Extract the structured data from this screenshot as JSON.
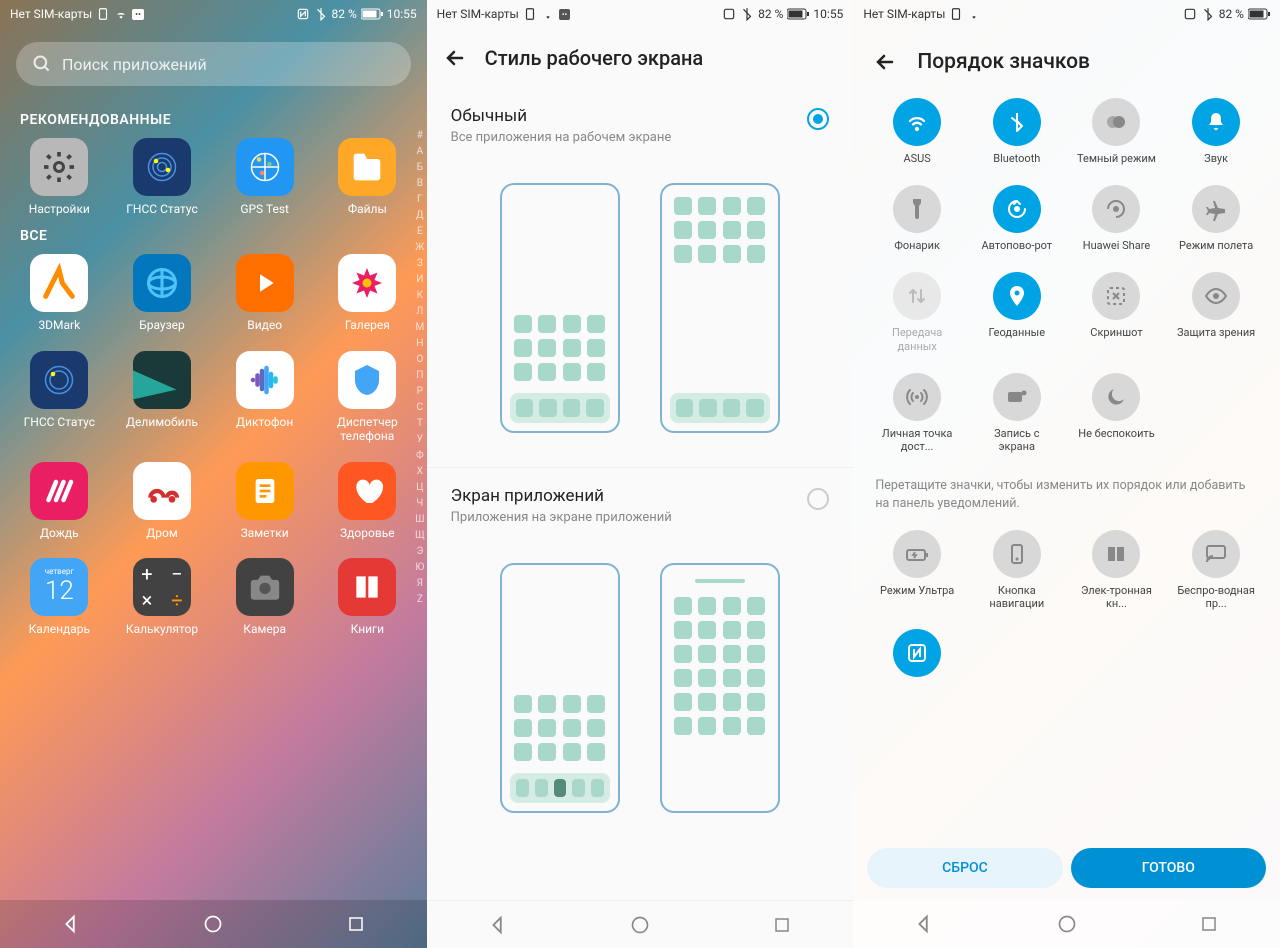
{
  "status": {
    "sim": "Нет SIM-карты",
    "battery": "82 %",
    "time": "10:55"
  },
  "phone1": {
    "search_placeholder": "Поиск приложений",
    "section_recommended": "РЕКОМЕНДОВАННЫЕ",
    "section_all": "ВСЕ",
    "recommended": [
      {
        "label": "Настройки"
      },
      {
        "label": "ГНСС Статус"
      },
      {
        "label": "GPS Test"
      },
      {
        "label": "Файлы"
      }
    ],
    "all": [
      {
        "label": "3DMark"
      },
      {
        "label": "Браузер"
      },
      {
        "label": "Видео"
      },
      {
        "label": "Галерея"
      },
      {
        "label": "ГНСС Статус"
      },
      {
        "label": "Делимобиль"
      },
      {
        "label": "Диктофон"
      },
      {
        "label": "Диспетчер телефона"
      },
      {
        "label": "Дождь"
      },
      {
        "label": "Дром"
      },
      {
        "label": "Заметки"
      },
      {
        "label": "Здоровье"
      },
      {
        "label": "Календарь"
      },
      {
        "label": "Калькулятор"
      },
      {
        "label": "Камера"
      },
      {
        "label": "Книги"
      }
    ],
    "calendar_day_label": "четверг",
    "calendar_day": "12",
    "alpha": [
      "#",
      "А",
      "Б",
      "В",
      "Г",
      "Д",
      "Е",
      "Ж",
      "З",
      "И",
      "К",
      "Л",
      "М",
      "Н",
      "О",
      "П",
      "Р",
      "С",
      "Т",
      "У",
      "Ф",
      "Х",
      "Ц",
      "Ч",
      "Ш",
      "Щ",
      "Э",
      "Ю",
      "Я",
      "Z"
    ]
  },
  "phone2": {
    "title": "Стиль рабочего экрана",
    "opt1_title": "Обычный",
    "opt1_sub": "Все приложения на рабочем экране",
    "opt2_title": "Экран приложений",
    "opt2_sub": "Приложения на экране приложений"
  },
  "phone3": {
    "title": "Порядок значков",
    "tiles": [
      {
        "label": "ASUS",
        "on": true,
        "icon": "wifi"
      },
      {
        "label": "Bluetooth",
        "on": true,
        "icon": "bluetooth"
      },
      {
        "label": "Темный режим",
        "on": false,
        "icon": "dark"
      },
      {
        "label": "Звук",
        "on": true,
        "icon": "bell"
      },
      {
        "label": "Фонарик",
        "on": false,
        "icon": "flashlight"
      },
      {
        "label": "Автопово-рот",
        "on": true,
        "icon": "rotate"
      },
      {
        "label": "Huawei Share",
        "on": false,
        "icon": "share"
      },
      {
        "label": "Режим полета",
        "on": false,
        "icon": "airplane"
      },
      {
        "label": "Передача данных",
        "on": false,
        "icon": "data",
        "dim": true
      },
      {
        "label": "Геоданные",
        "on": true,
        "icon": "location"
      },
      {
        "label": "Скриншот",
        "on": false,
        "icon": "screenshot"
      },
      {
        "label": "Защита зрения",
        "on": false,
        "icon": "eye"
      },
      {
        "label": "Личная точка дост...",
        "on": false,
        "icon": "hotspot"
      },
      {
        "label": "Запись с экрана",
        "on": false,
        "icon": "record"
      },
      {
        "label": "Не беспокоить",
        "on": false,
        "icon": "moon"
      }
    ],
    "hint": "Перетащите значки, чтобы изменить их порядок или добавить на панель уведомлений.",
    "tiles2": [
      {
        "label": "Режим Ультра",
        "icon": "ultra"
      },
      {
        "label": "Кнопка навигации",
        "icon": "navkey"
      },
      {
        "label": "Элек-тронная кн...",
        "icon": "ebook"
      },
      {
        "label": "Беспро-водная пр...",
        "icon": "cast"
      },
      {
        "label": "",
        "icon": "nfc",
        "on": true
      }
    ],
    "btn_reset": "СБРОС",
    "btn_done": "ГОТОВО"
  }
}
